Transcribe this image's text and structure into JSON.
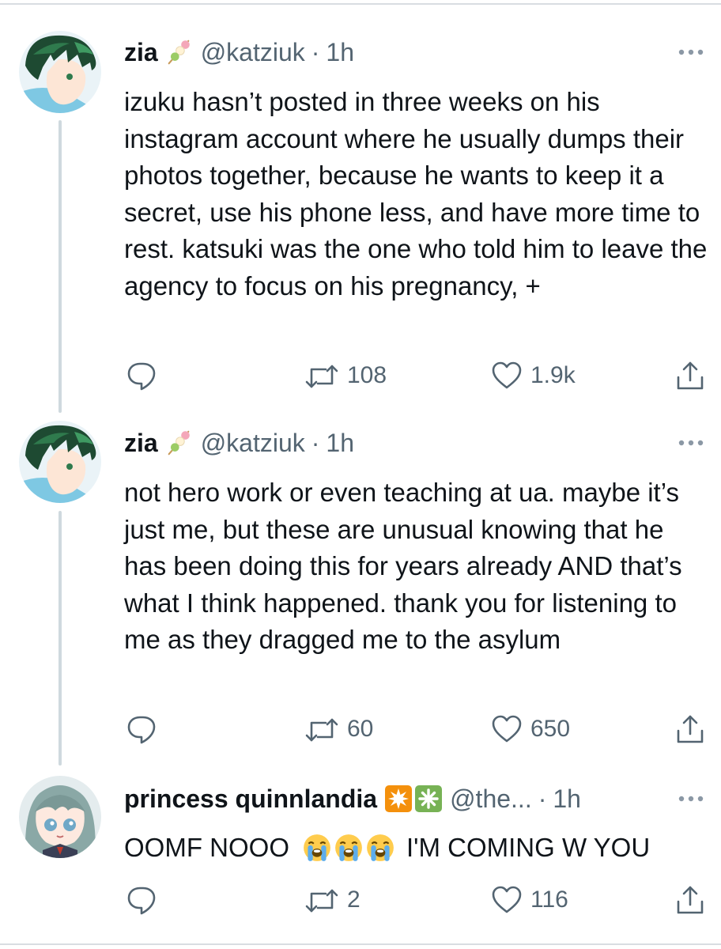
{
  "tweets": [
    {
      "name": "zia",
      "handle": "@katziuk",
      "time": "1h",
      "text": "izuku hasn’t posted in three weeks on his instagram account where he usually dumps their photos together, because he wants to keep it a secret, use his phone less, and have more time to rest. katsuki was the one who told him to leave the agency to focus on his pregnancy, +",
      "retweets": "108",
      "likes": "1.9k",
      "name_emoji": "dango-icon",
      "avatar": "green-haired-anime-avatar"
    },
    {
      "name": "zia",
      "handle": "@katziuk",
      "time": "1h",
      "text": "not hero work or even teaching at ua. maybe it’s just me, but these are unusual knowing that he has been doing this for years already AND that’s what I think happened. thank you for listening to me as they dragged me to the asylum",
      "retweets": "60",
      "likes": "650",
      "name_emoji": "dango-icon",
      "avatar": "green-haired-anime-avatar"
    },
    {
      "name": "princess quinnlandia",
      "handle": "@the...",
      "time": "1h",
      "text_before": "OOMF NOOO",
      "text_after": "I'M COMING W YOU",
      "text_emojis": [
        "loudly-crying-face-icon",
        "loudly-crying-face-icon",
        "loudly-crying-face-icon"
      ],
      "retweets": "2",
      "likes": "116",
      "name_emojis": [
        "eight-pointed-star-icon",
        "eight-spoked-asterisk-icon"
      ],
      "avatar": "teal-haired-chibi-avatar"
    }
  ],
  "separator": "·",
  "colors": {
    "text": "#0f1419",
    "secondary": "#536471",
    "connector": "#cfd9de"
  }
}
